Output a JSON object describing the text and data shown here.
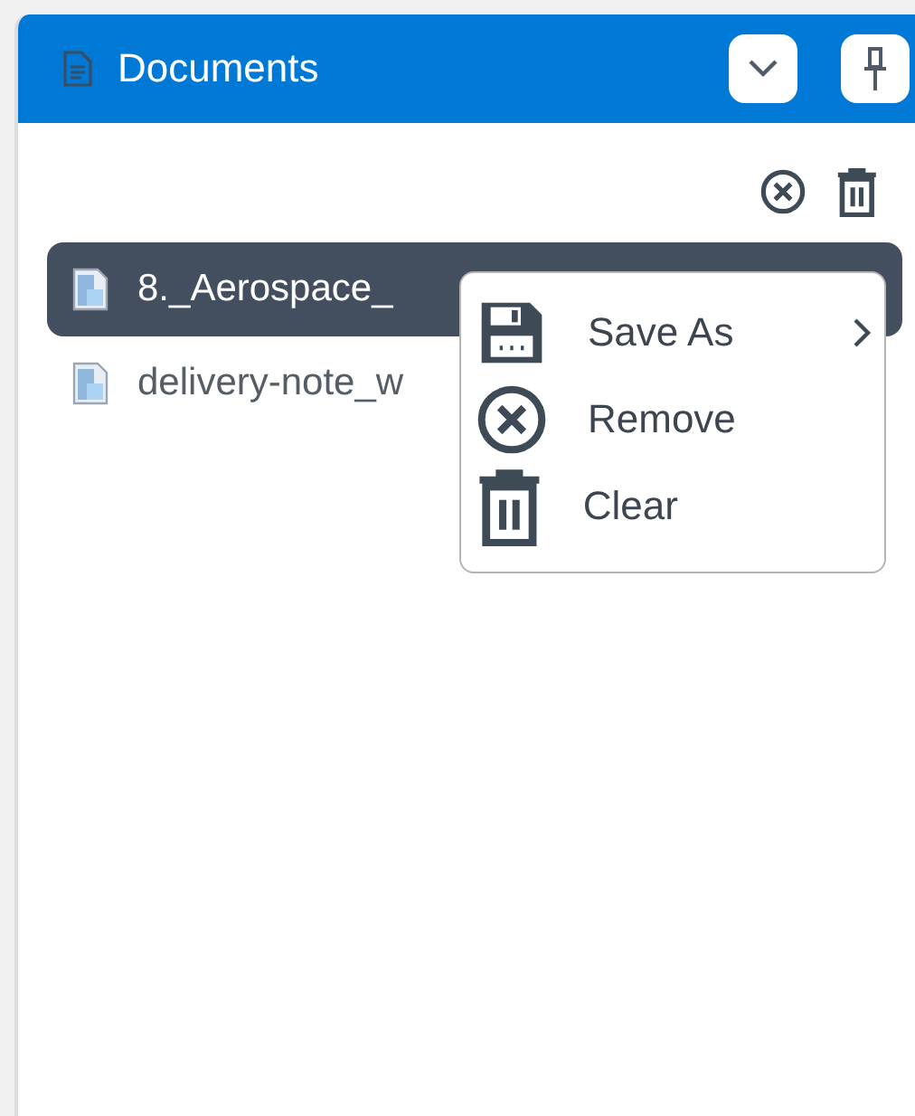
{
  "panel": {
    "title": "Documents"
  },
  "files": [
    {
      "name": "8._Aerospace_",
      "selected": true
    },
    {
      "name": "delivery-note_w",
      "selected": false
    }
  ],
  "context_menu": {
    "items": [
      {
        "label": "Save As",
        "kind": "save",
        "has_submenu": true
      },
      {
        "label": "Remove",
        "kind": "remove",
        "has_submenu": false
      },
      {
        "label": "Clear",
        "kind": "clear",
        "has_submenu": false
      }
    ]
  }
}
